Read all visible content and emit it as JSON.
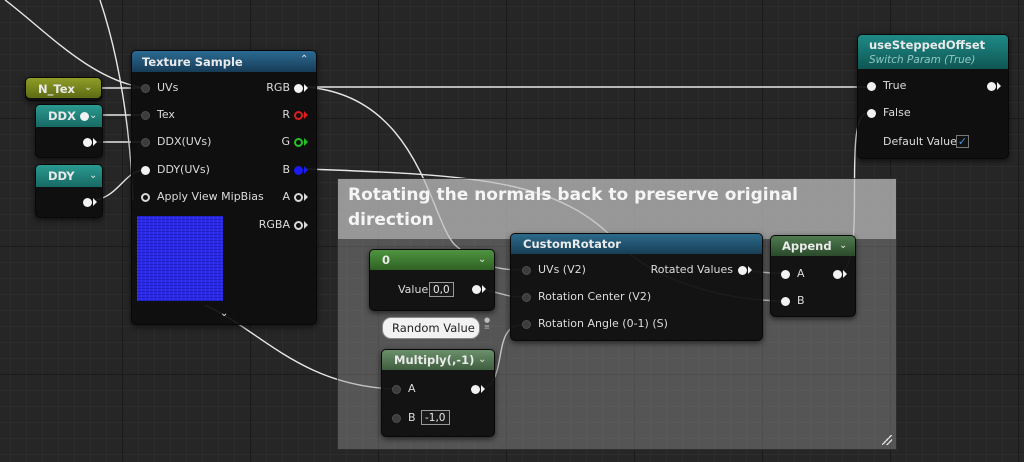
{
  "comment_box": {
    "title": "Rotating the normals back to preserve original direction"
  },
  "texture_sample": {
    "title": "Texture Sample",
    "inputs": [
      "UVs",
      "Tex",
      "DDX(UVs)",
      "DDY(UVs)",
      "Apply View MipBias"
    ],
    "outputs": [
      "RGB",
      "R",
      "G",
      "B",
      "A",
      "RGBA"
    ]
  },
  "n_tex": {
    "title": "N_Tex"
  },
  "ddx": {
    "title": "DDX"
  },
  "ddy": {
    "title": "DDY"
  },
  "switch": {
    "title": "useSteppedOffset",
    "subtitle": "Switch Param (True)",
    "true_label": "True",
    "false_label": "False",
    "default_label": "Default Value",
    "default_checked": true
  },
  "constant2": {
    "title": "0",
    "value_label": "Value",
    "value": "0,0"
  },
  "custom_rotator": {
    "title": "CustomRotator",
    "inputs": [
      "UVs (V2)",
      "Rotation Center (V2)",
      "Rotation Angle (0-1) (S)"
    ],
    "output": "Rotated Values"
  },
  "append": {
    "title": "Append",
    "input_a": "A",
    "input_b": "B"
  },
  "multiply": {
    "title": "Multiply(,-1)",
    "input_a": "A",
    "input_b": "B",
    "b_value": "-1,0"
  },
  "random_value": {
    "label": "Random Value"
  },
  "colors": {
    "texture_header": "#1f4e6e",
    "param_header": "#7a8a1e",
    "ddx_header": "#1f7a72",
    "switch_header": "#15706e",
    "constant_header": "#3f7a30",
    "custom_header": "#20506a",
    "append_header": "#3a5a3a",
    "multiply_header": "#4c6a4c",
    "wire": "#e8e8e8",
    "preview_blue": "#2a2ae8"
  }
}
